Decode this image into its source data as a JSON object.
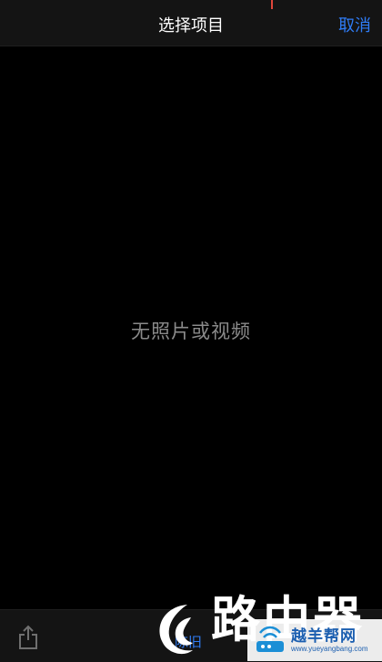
{
  "nav": {
    "title": "选择项目",
    "cancel_label": "取消"
  },
  "content": {
    "empty_message": "无照片或视频"
  },
  "toolbar": {
    "share_icon": "share-icon",
    "partial_label": "陈旧"
  },
  "watermark": {
    "text_1": "路由器",
    "text_2": "越羊帮网",
    "url": "www.yueyangbang.com"
  },
  "colors": {
    "accent": "#2f7cf6",
    "background": "#000000",
    "bar": "#141414",
    "muted_text": "#8a8a8a",
    "marker": "#e0463a"
  }
}
